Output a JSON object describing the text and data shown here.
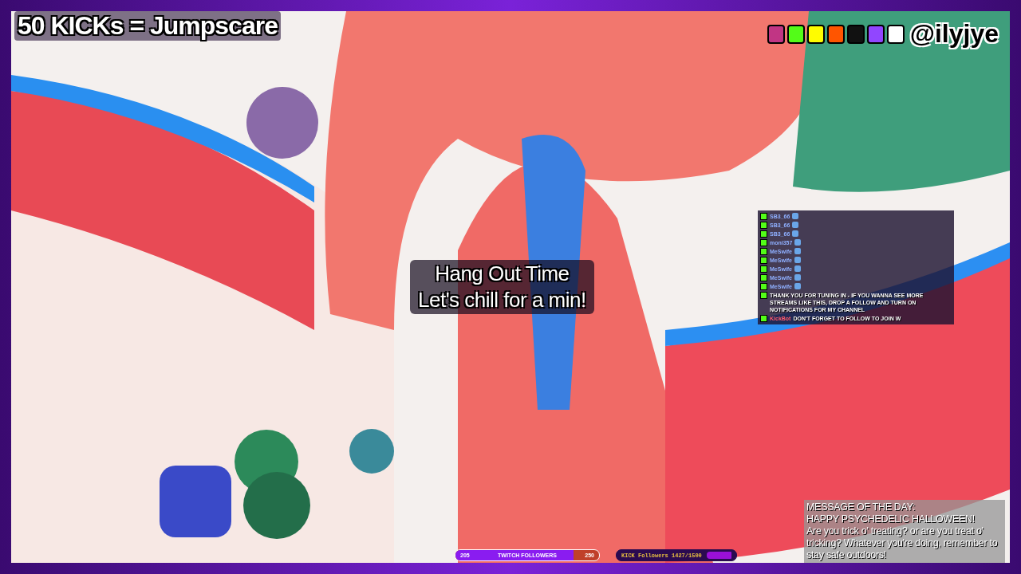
{
  "overlay": {
    "title": "50 KICKs = Jumpscare",
    "handle": "@ilyjye"
  },
  "caption": {
    "lines": [
      "Hang Out Time",
      "Let's chill for a min!"
    ]
  },
  "chat": [
    {
      "user": "SB3_66"
    },
    {
      "user": "SB3_66"
    },
    {
      "user": "SB3_66"
    },
    {
      "user": "moni357"
    },
    {
      "user": "MeSwife"
    },
    {
      "user": "MeSwife"
    },
    {
      "user": "MeSwife"
    },
    {
      "user": "MeSwife"
    },
    {
      "user": "MeSwife"
    },
    {
      "text": "THANK YOU FOR TUNING IN - IF YOU WANNA SEE MORE STREAMS LIKE THIS, DROP A FOLLOW AND TURN ON NOTIFICATIONS FOR MY CHANNEL"
    },
    {
      "user": "KickBot",
      "text": "DON'T FORGET TO FOLLOW TO JOIN W"
    }
  ],
  "goals": [
    {
      "kind": "twitch",
      "start": "205",
      "label": "TWITCH FOLLOWERS",
      "end": "250",
      "level": 0.82
    },
    {
      "kind": "kick",
      "label": "KICK Followers 1427/1500",
      "level": 0.95
    }
  ],
  "message_of_the_day": {
    "heading": "MESSAGE OF THE DAY:",
    "subheading": "HAPPY PSYCHEDELIC HALLOWEEN!",
    "body": "Are you trick o' treating? or are you treat o' tricking? Whatever you're doing, remember to stay safe outdoors!"
  }
}
